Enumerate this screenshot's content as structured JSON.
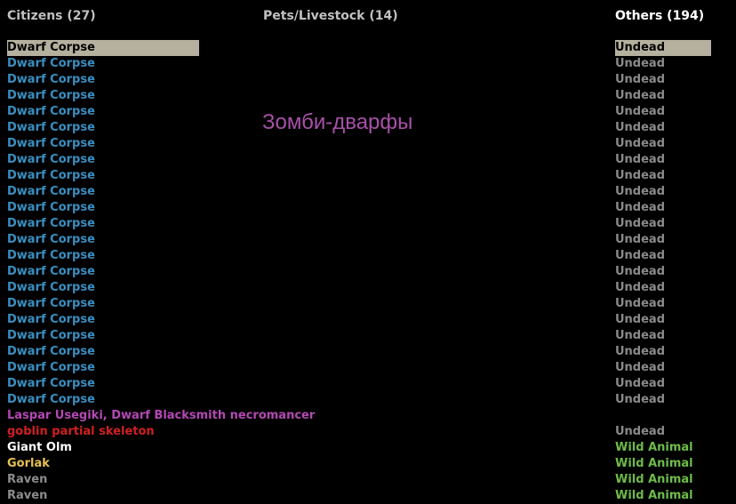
{
  "headers": {
    "citizens": "Citizens (27)",
    "pets": "Pets/Livestock (14)",
    "others": "Others (194)"
  },
  "overlay_caption": "Зомби-дварфы",
  "units": [
    {
      "name": "Dwarf Corpse",
      "name_color": "blue",
      "type": "Undead",
      "type_color": "ugray",
      "selected": true
    },
    {
      "name": "Dwarf Corpse",
      "name_color": "blue",
      "type": "Undead",
      "type_color": "ugray"
    },
    {
      "name": "Dwarf Corpse",
      "name_color": "blue",
      "type": "Undead",
      "type_color": "ugray"
    },
    {
      "name": "Dwarf Corpse",
      "name_color": "blue",
      "type": "Undead",
      "type_color": "ugray"
    },
    {
      "name": "Dwarf Corpse",
      "name_color": "blue",
      "type": "Undead",
      "type_color": "ugray"
    },
    {
      "name": "Dwarf Corpse",
      "name_color": "blue",
      "type": "Undead",
      "type_color": "ugray"
    },
    {
      "name": "Dwarf Corpse",
      "name_color": "blue",
      "type": "Undead",
      "type_color": "ugray"
    },
    {
      "name": "Dwarf Corpse",
      "name_color": "blue",
      "type": "Undead",
      "type_color": "ugray"
    },
    {
      "name": "Dwarf Corpse",
      "name_color": "blue",
      "type": "Undead",
      "type_color": "ugray"
    },
    {
      "name": "Dwarf Corpse",
      "name_color": "blue",
      "type": "Undead",
      "type_color": "ugray"
    },
    {
      "name": "Dwarf Corpse",
      "name_color": "blue",
      "type": "Undead",
      "type_color": "ugray"
    },
    {
      "name": "Dwarf Corpse",
      "name_color": "blue",
      "type": "Undead",
      "type_color": "ugray"
    },
    {
      "name": "Dwarf Corpse",
      "name_color": "blue",
      "type": "Undead",
      "type_color": "ugray"
    },
    {
      "name": "Dwarf Corpse",
      "name_color": "blue",
      "type": "Undead",
      "type_color": "ugray"
    },
    {
      "name": "Dwarf Corpse",
      "name_color": "blue",
      "type": "Undead",
      "type_color": "ugray"
    },
    {
      "name": "Dwarf Corpse",
      "name_color": "blue",
      "type": "Undead",
      "type_color": "ugray"
    },
    {
      "name": "Dwarf Corpse",
      "name_color": "blue",
      "type": "Undead",
      "type_color": "ugray"
    },
    {
      "name": "Dwarf Corpse",
      "name_color": "blue",
      "type": "Undead",
      "type_color": "ugray"
    },
    {
      "name": "Dwarf Corpse",
      "name_color": "blue",
      "type": "Undead",
      "type_color": "ugray"
    },
    {
      "name": "Dwarf Corpse",
      "name_color": "blue",
      "type": "Undead",
      "type_color": "ugray"
    },
    {
      "name": "Dwarf Corpse",
      "name_color": "blue",
      "type": "Undead",
      "type_color": "ugray"
    },
    {
      "name": "Dwarf Corpse",
      "name_color": "blue",
      "type": "Undead",
      "type_color": "ugray"
    },
    {
      "name": "Dwarf Corpse",
      "name_color": "blue",
      "type": "Undead",
      "type_color": "ugray"
    },
    {
      "name": "Laspar Usegiki, Dwarf Blacksmith necromancer",
      "name_color": "purple",
      "type": "",
      "type_color": "ugray"
    },
    {
      "name": "goblin partial skeleton",
      "name_color": "red",
      "type": "Undead",
      "type_color": "ugray"
    },
    {
      "name": "Giant Olm",
      "name_color": "white",
      "type": "Wild Animal",
      "type_color": "green"
    },
    {
      "name": "Gorlak",
      "name_color": "yellow",
      "type": "Wild Animal",
      "type_color": "green"
    },
    {
      "name": "Raven",
      "name_color": "gray",
      "type": "Wild Animal",
      "type_color": "green"
    },
    {
      "name": "Raven",
      "name_color": "gray",
      "type": "Wild Animal",
      "type_color": "green"
    }
  ]
}
